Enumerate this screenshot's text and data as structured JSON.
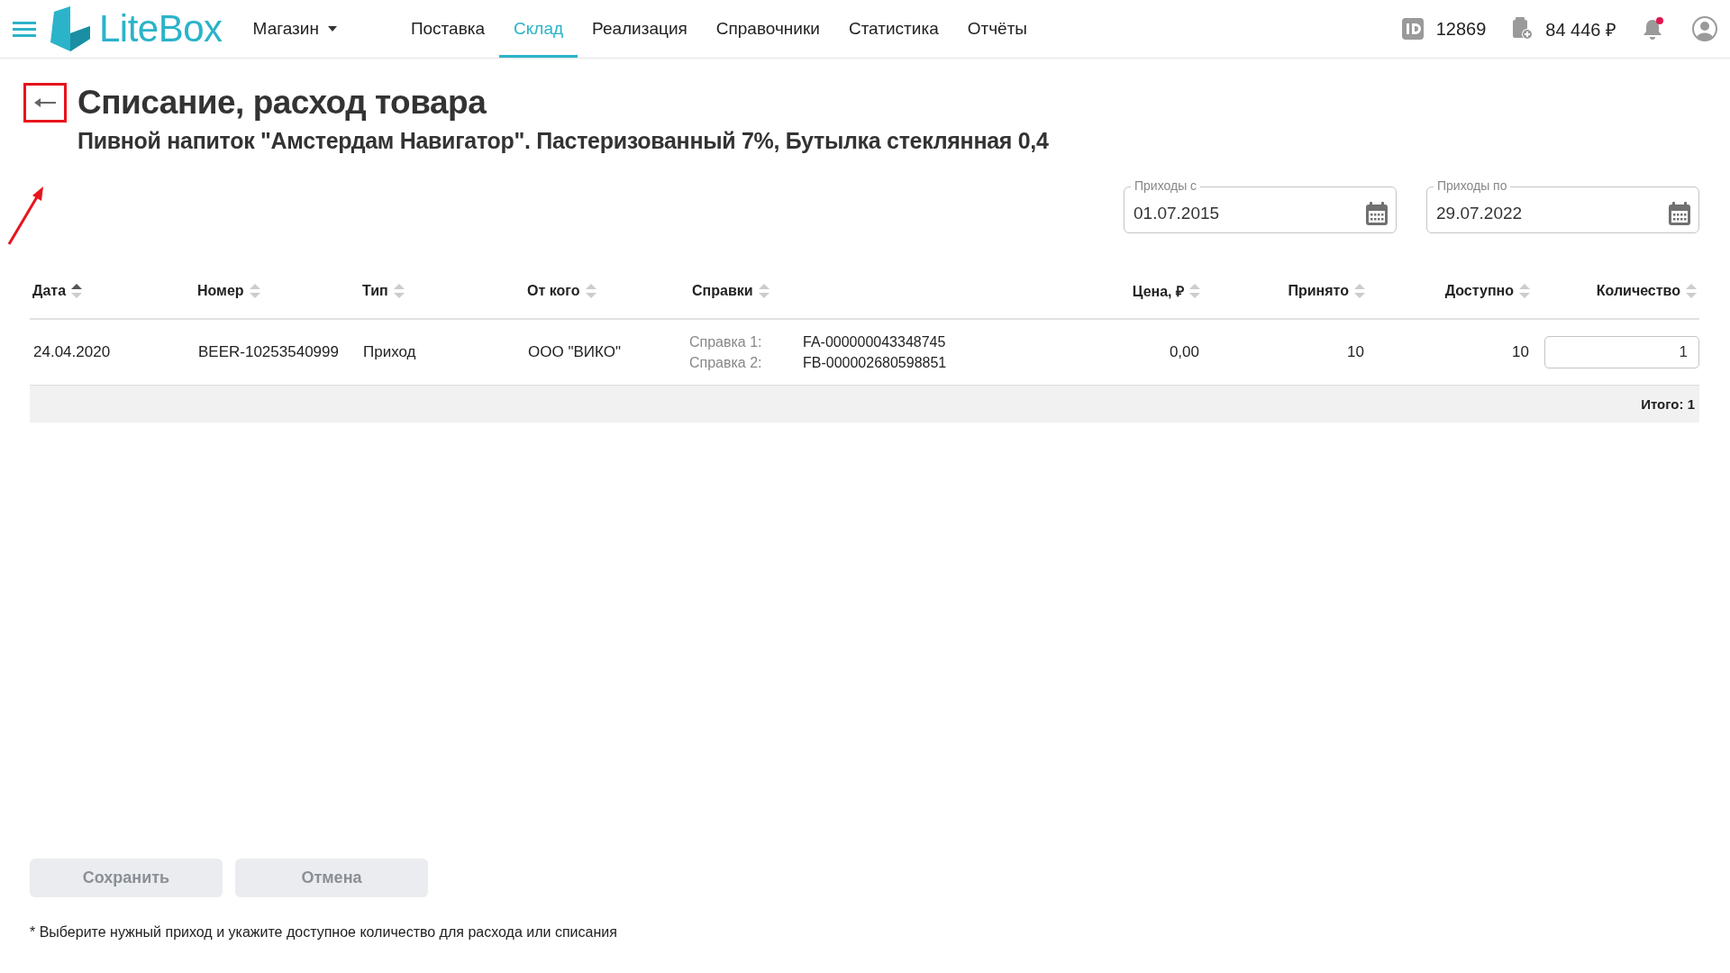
{
  "topbar": {
    "brand": "LiteBox",
    "store": "Магазин",
    "nav": [
      {
        "label": "Поставка",
        "selected": false
      },
      {
        "label": "Склад",
        "selected": true
      },
      {
        "label": "Реализация",
        "selected": false
      },
      {
        "label": "Справочники",
        "selected": false
      },
      {
        "label": "Статистика",
        "selected": false
      },
      {
        "label": "Отчёты",
        "selected": false
      }
    ],
    "account_id": "12869",
    "balance": "84 446 ₽",
    "notifications_unread": true
  },
  "header": {
    "title": "Списание, расход товара",
    "subtitle": "Пивной напиток \"Амстердам Навигатор\". Пастеризованный 7%, Бутылка стеклянная 0,4",
    "back_highlighted": true
  },
  "filters": [
    {
      "label": "Приходы с",
      "value": "01.07.2015"
    },
    {
      "label": "Приходы по",
      "value": "29.07.2022"
    }
  ],
  "table": {
    "columns": [
      {
        "label": "Дата",
        "sorted": true
      },
      {
        "label": "Номер",
        "sorted": false
      },
      {
        "label": "Тип",
        "sorted": false
      },
      {
        "label": "От кого",
        "sorted": false
      },
      {
        "label": "Справки",
        "sorted": false
      },
      {
        "label": "Цена, ₽",
        "sorted": false
      },
      {
        "label": "Принято",
        "sorted": false
      },
      {
        "label": "Доступно",
        "sorted": false
      },
      {
        "label": "Количество",
        "sorted": false
      }
    ],
    "rows": [
      {
        "date": "24.04.2020",
        "number": "BEER-10253540999",
        "type": "Приход",
        "from": "ООО \"ВИКО\"",
        "certificates": [
          {
            "label": "Справка 1:",
            "value": "FA-000000043348745"
          },
          {
            "label": "Справка 2:",
            "value": "FB-000002680598851"
          }
        ],
        "price": "0,00",
        "received": "10",
        "available": "10",
        "quantity": "1"
      }
    ],
    "total": "Итого: 1"
  },
  "buttons": [
    {
      "label": "Сохранить",
      "disabled": true
    },
    {
      "label": "Отмена",
      "disabled": true
    }
  ],
  "note": "* Выберите нужный приход и укажите доступное количество для расхода или списания"
}
